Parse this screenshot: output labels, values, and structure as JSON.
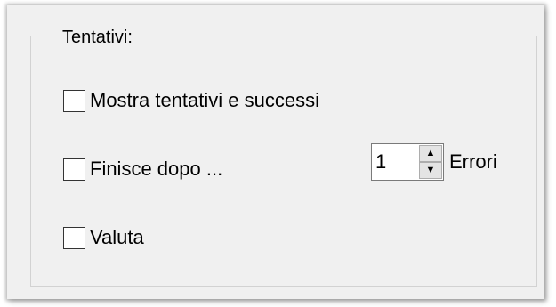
{
  "group": {
    "title": "Tentativi:"
  },
  "options": [
    {
      "label": "Mostra tentativi e successi",
      "checked": false
    },
    {
      "label": "Finisce dopo ...",
      "checked": false
    },
    {
      "label": "Valuta",
      "checked": false
    }
  ],
  "error_limit": {
    "value": "1",
    "unit_label": "Errori",
    "up_icon": "triangle-up-icon",
    "down_icon": "triangle-down-icon"
  }
}
